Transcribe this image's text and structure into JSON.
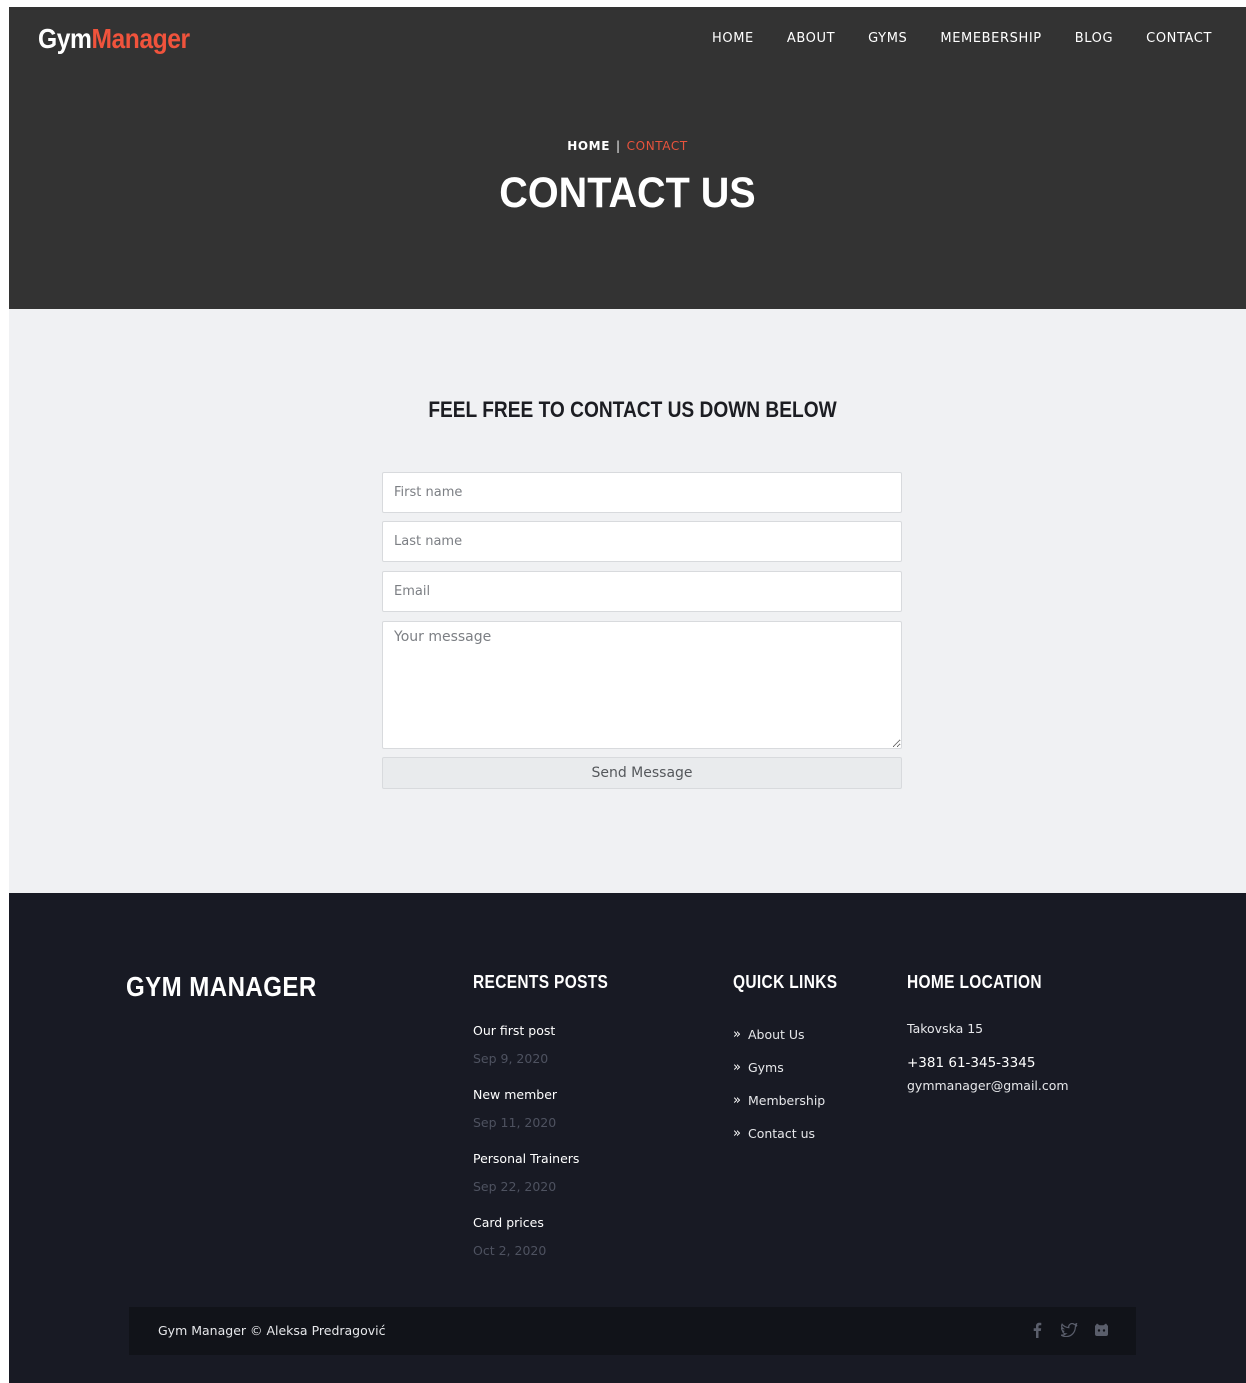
{
  "brand": {
    "part1": "Gym",
    "part2": "Manager"
  },
  "nav": [
    {
      "label": "HOME"
    },
    {
      "label": "ABOUT"
    },
    {
      "label": "GYMS"
    },
    {
      "label": "MEMEBERSHIP"
    },
    {
      "label": "BLOG"
    },
    {
      "label": "CONTACT"
    }
  ],
  "breadcrumb": {
    "home": "HOME",
    "separator": "|",
    "current": "CONTACT"
  },
  "page_title": "CONTACT US",
  "contact": {
    "heading": "FEEL FREE TO CONTACT US DOWN BELOW",
    "first_name_placeholder": "First name",
    "last_name_placeholder": "Last name",
    "email_placeholder": "Email",
    "message_placeholder": "Your message",
    "send_label": "Send Message"
  },
  "footer": {
    "brand": "GYM MANAGER",
    "recent_posts_title": "RECENTS POSTS",
    "posts": [
      {
        "title": "Our first post",
        "date": "Sep 9, 2020"
      },
      {
        "title": "New member",
        "date": "Sep 11, 2020"
      },
      {
        "title": "Personal Trainers",
        "date": "Sep 22, 2020"
      },
      {
        "title": "Card prices",
        "date": "Oct 2, 2020"
      }
    ],
    "quick_links_title": "QUICK LINKS",
    "quick_links": [
      {
        "label": "About Us"
      },
      {
        "label": "Gyms"
      },
      {
        "label": "Membership"
      },
      {
        "label": "Contact us"
      }
    ],
    "location_title": "HOME LOCATION",
    "address": "Takovska 15",
    "phone": "+381 61-345-3345",
    "email": "gymmanager@gmail.com",
    "copyright": "Gym Manager © Aleksa Predragović",
    "socials": [
      "facebook-icon",
      "twitter-icon",
      "github-icon"
    ]
  },
  "colors": {
    "accent": "#f0533c",
    "header_bg": "#333333",
    "content_bg": "#f0f1f3",
    "footer_bg": "#181a24",
    "bottom_bar_bg": "#111319"
  }
}
